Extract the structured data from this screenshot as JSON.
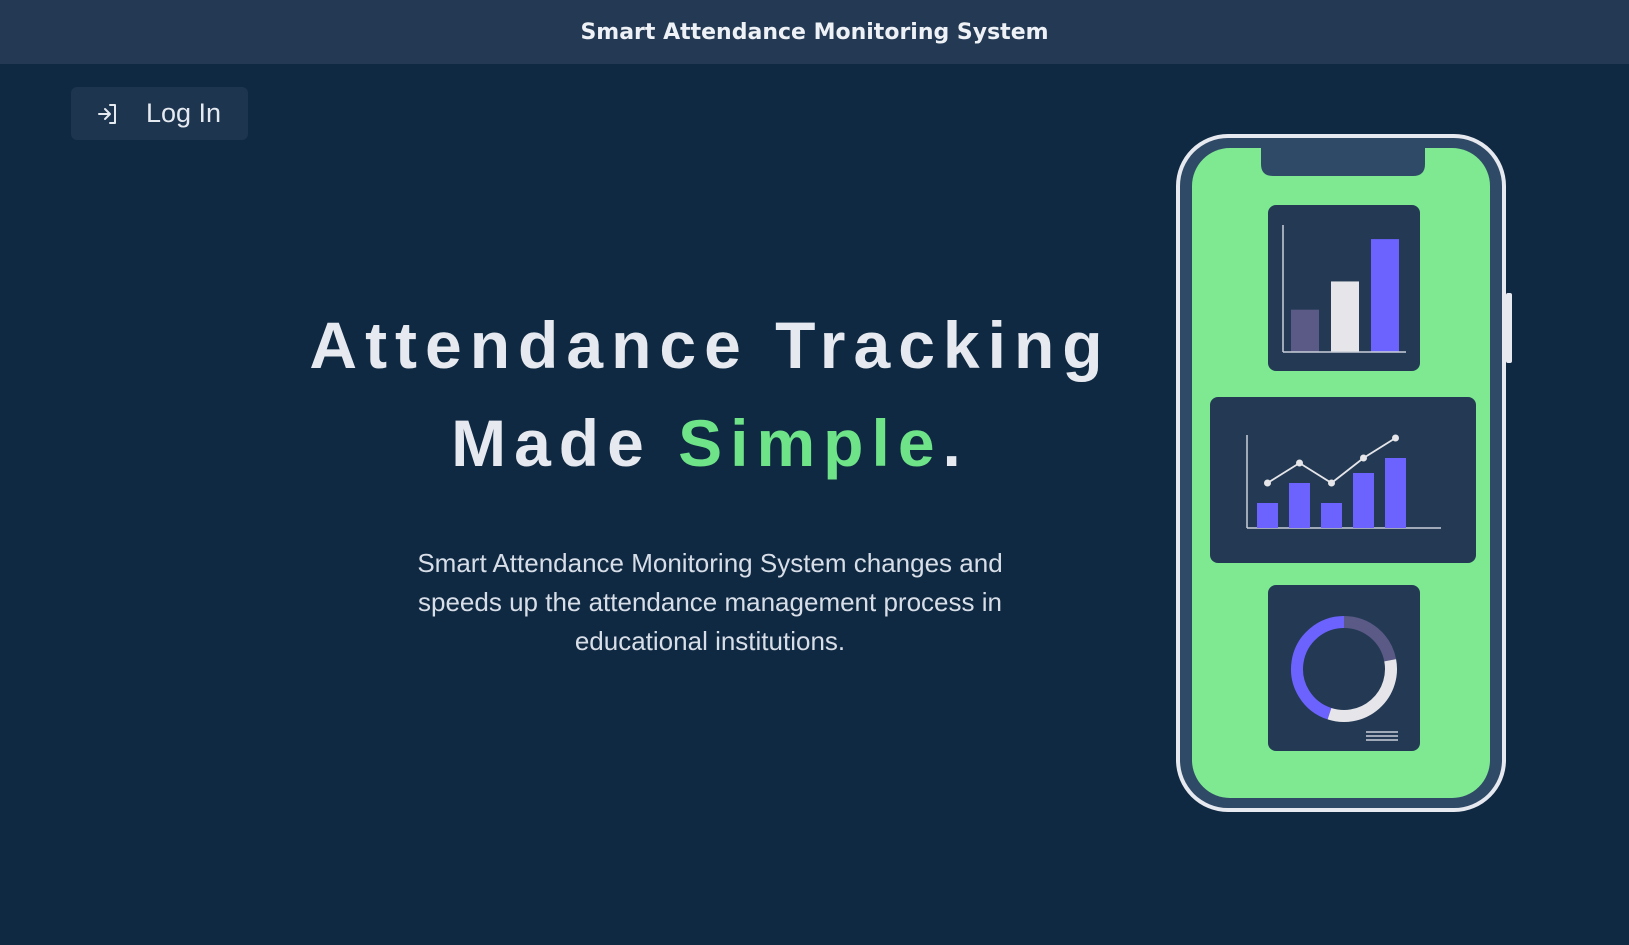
{
  "header": {
    "title": "Smart Attendance Monitoring System"
  },
  "login": {
    "label": "Log In",
    "icon": "login-icon"
  },
  "hero": {
    "line1": "Attendance Tracking",
    "line2_prefix": "Made ",
    "line2_accent": "Simple",
    "line2_suffix": ".",
    "description": "Smart Attendance Monitoring System changes and speeds up the attendance management process in educational institutions."
  },
  "colors": {
    "background": "#0f2942",
    "header": "#243a54",
    "accent_green": "#6ee387",
    "chart_purple": "#6c63ff",
    "card_dark": "#243a54"
  },
  "illustration": {
    "type": "phone-dashboard",
    "bar_chart_values": [
      3,
      5,
      8
    ],
    "combo_bars": [
      2.5,
      4.5,
      2.5,
      5.5,
      7
    ],
    "combo_line": [
      4.5,
      6.5,
      4.5,
      7,
      9
    ],
    "donut_segments": [
      0.45,
      0.22,
      0.33
    ]
  }
}
